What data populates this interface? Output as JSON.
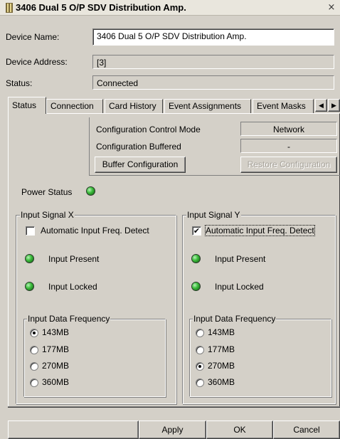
{
  "window": {
    "title": "3406 Dual 5 O/P SDV Distribution Amp.",
    "app_icon": "device-icon",
    "close_glyph": "×"
  },
  "device": {
    "name_label": "Device Name:",
    "name_value": "3406 Dual 5 O/P SDV Distribution Amp.",
    "address_label": "Device Address:",
    "address_value": "[3]",
    "status_label": "Status:",
    "status_value": "Connected"
  },
  "tabs": [
    {
      "label": "Status",
      "active": true
    },
    {
      "label": "Connection",
      "active": false
    },
    {
      "label": "Card History",
      "active": false
    },
    {
      "label": "Event Assignments",
      "active": false
    },
    {
      "label": "Event Masks",
      "active": false
    }
  ],
  "tab_scroll": {
    "left": "◀",
    "right": "▶"
  },
  "config": {
    "control_mode_label": "Configuration Control Mode",
    "control_mode_value": "Network",
    "buffered_label": "Configuration Buffered",
    "buffered_value": "-",
    "buffer_button": "Buffer Configuration",
    "restore_button": "Restore Configuration"
  },
  "power_status": {
    "label": "Power Status",
    "led_color": "#3fbf3f"
  },
  "input_x": {
    "title": "Input Signal X",
    "auto_detect_label": "Automatic Input Freq. Detect",
    "auto_detect_checked": false,
    "present_label": "Input Present",
    "locked_label": "Input Locked",
    "freq_title": "Input Data Frequency",
    "freq_options": [
      "143MB",
      "177MB",
      "270MB",
      "360MB"
    ],
    "freq_selected": "143MB"
  },
  "input_y": {
    "title": "Input Signal Y",
    "auto_detect_label": "Automatic Input Freq. Detect",
    "auto_detect_checked": true,
    "present_label": "Input Present",
    "locked_label": "Input Locked",
    "freq_title": "Input Data Frequency",
    "freq_options": [
      "143MB",
      "177MB",
      "270MB",
      "360MB"
    ],
    "freq_selected": "270MB"
  },
  "buttons": {
    "apply": "Apply",
    "ok": "OK",
    "cancel": "Cancel"
  },
  "colors": {
    "led_green": "#3fbf3f",
    "dialog_bg": "#d4d0c8"
  }
}
